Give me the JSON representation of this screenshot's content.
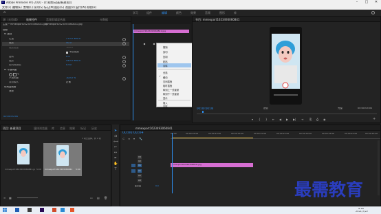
{
  "titlebar": {
    "title": "Adobe Premiere Pro 2020 - D:\\视频\\动画\\新建项目"
  },
  "menu": [
    "文件(F)",
    "编辑(E)",
    "剪辑(C)",
    "序列(S)",
    "标记(M)",
    "图形(G)",
    "视图(V)",
    "窗口(W)",
    "帮助(H)"
  ],
  "workspace_tabs": [
    {
      "label": "学习",
      "active": false
    },
    {
      "label": "组件",
      "active": false
    },
    {
      "label": "编辑",
      "active": true
    },
    {
      "label": "颜色",
      "active": false
    },
    {
      "label": "效果",
      "active": false
    },
    {
      "label": "音频",
      "active": false
    },
    {
      "label": "图形",
      "active": false
    },
    {
      "label": "库",
      "active": false
    }
  ],
  "source_panel": {
    "tabs": [
      "源: (无剪辑)",
      "效果控件",
      "音频剪辑混合器",
      "元数据"
    ],
    "clip_path": "主要 * mmexport1623493060841.jpg",
    "sequence_name": "mmexport1623493060841.jpg",
    "clip_bar_label": "mmexport1623493060841.jpg",
    "section_video": "视频",
    "section_motion": "fx 运动",
    "rows": [
      {
        "label": "位置",
        "value": "270.0  480.0"
      },
      {
        "label": "缩放",
        "value": "50.0"
      },
      {
        "label": "缩放宽度",
        "value": "100.0"
      },
      {
        "label": "等比缩放",
        "value": "✓"
      },
      {
        "label": "旋转",
        "value": "0.0"
      },
      {
        "label": "锚点",
        "value": "540.0  960.0"
      },
      {
        "label": "防闪烁滤镜",
        "value": "0.00"
      }
    ],
    "opacity_label": "fx 不透明度",
    "opacity_value": "100.0 %",
    "blend_label": "混合模式",
    "blend_value": "正常",
    "time_remap": "时间重映射",
    "speed_label": "速度",
    "timecode": "00:00:00:00"
  },
  "context_menu": {
    "items": [
      {
        "label": "撤销",
        "sep_after": false
      },
      {
        "label": "剪切",
        "sep_after": false
      },
      {
        "label": "复制",
        "sep_after": false
      },
      {
        "label": "粘贴",
        "sep_after": false
      },
      {
        "label": "清除",
        "sep_after": true,
        "selected": true
      },
      {
        "label": "全选",
        "sep_after": false
      },
      {
        "label": "缓动",
        "checked": true,
        "sep_after": false
      },
      {
        "label": "空间插值",
        "sep_after": false
      },
      {
        "label": "临时插值",
        "sep_after": false
      },
      {
        "label": "转到上一关键帧",
        "sep_after": false
      },
      {
        "label": "转到下一关键帧",
        "sep_after": false
      },
      {
        "label": "显示",
        "sep_after": true
      },
      {
        "label": "插入",
        "sep_after": false
      },
      {
        "label": "清除",
        "sep_after": false
      }
    ]
  },
  "program_panel": {
    "tab": "节目: mmexport1623493060841",
    "timecode_left": "00:00:00:04",
    "fit": "适合",
    "quality": "完整",
    "timecode_right": "00:00:05:00"
  },
  "project_panel": {
    "tabs": [
      "项目: 新建项目",
      "媒体浏览器",
      "库",
      "信息",
      "效果",
      "标记",
      "历史"
    ],
    "items": [
      {
        "name": "mmexport1623493060841.jpg",
        "duration": "5:00"
      },
      {
        "name": "mmexport1623493060841",
        "duration": "5:00"
      }
    ],
    "count": "1 项已选择，共 2 项"
  },
  "timeline": {
    "tab": "mmexport1623493060841",
    "timecode": "00:00:00:04",
    "ruler": [
      "00:00",
      "00:00:05:00",
      "00:00:10:00",
      "00:00:15:00",
      "00:00:20:00",
      "00:00:25:00",
      "00:00:30:00",
      "00:00:35:00",
      "00:00:40:00",
      "00:00:45:00"
    ],
    "tracks_video": [
      "V3",
      "V2",
      "V1"
    ],
    "tracks_audio": [
      "A1",
      "A2",
      "A3"
    ],
    "master": "主声道",
    "master_value": "0.0",
    "clip_label": "mmexport1623493060841.jpg"
  },
  "watermark": "最需教育",
  "taskbar": {
    "time": "9:16",
    "date": "2021/7/22"
  },
  "colors": {
    "accent": "#2d8ceb",
    "clip": "#d66ed2",
    "timeline_marker": "#f0c64e"
  }
}
